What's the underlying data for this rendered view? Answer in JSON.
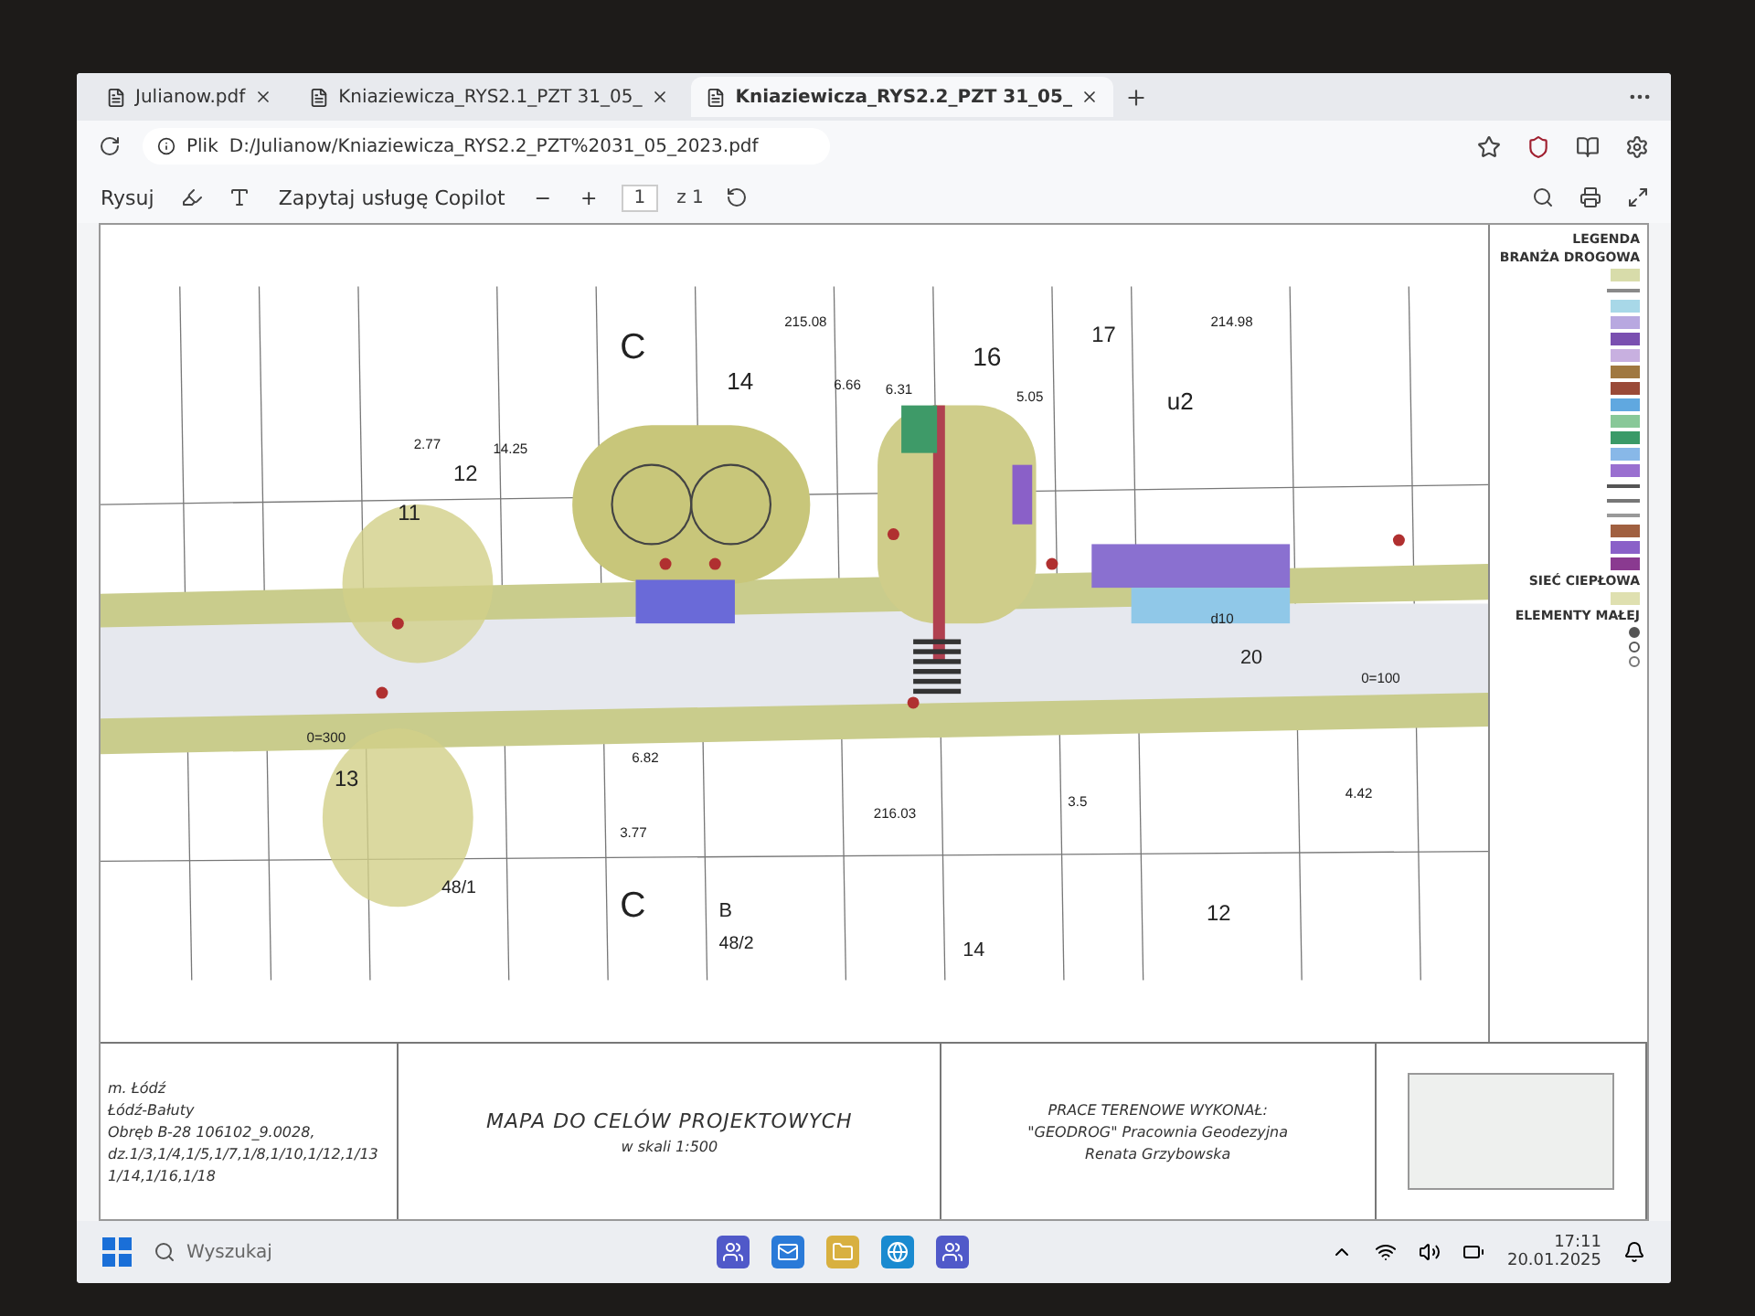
{
  "browser": {
    "tabs": [
      {
        "label": "Julianow.pdf",
        "selected": false
      },
      {
        "label": "Kniaziewicza_RYS2.1_PZT 31_05_",
        "selected": false
      },
      {
        "label": "Kniaziewicza_RYS2.2_PZT 31_05_",
        "selected": true
      }
    ],
    "address": {
      "scheme": "Plik",
      "url": "D:/Julianow/Kniaziewicza_RYS2.2_PZT%2031_05_2023.pdf"
    },
    "pdf_toolbar": {
      "draw": "Rysuj",
      "copilot": "Zapytaj usługę Copilot",
      "zoom_out": "−",
      "zoom_in": "+",
      "page": "1",
      "page_count": "z 1"
    }
  },
  "drawing": {
    "labels": [
      "C",
      "14",
      "16",
      "17",
      "u2",
      "11",
      "12",
      "13",
      "20",
      "B",
      "48/1",
      "48/2",
      "C",
      "14",
      "12",
      "6.66",
      "6.31",
      "5.05",
      "14.25",
      "2.77",
      "3.77",
      "3.5",
      "4.42",
      "6.82",
      "215.08",
      "214.98",
      "216.03",
      "d10",
      "0=100",
      "0=300"
    ],
    "legend": {
      "title": "LEGENDA",
      "sections": [
        {
          "heading": "BRANŻA DROGOWA",
          "items": [
            {
              "kind": "swatch",
              "color": "#d8dcaa"
            },
            {
              "kind": "line",
              "color": "#8a8a8a"
            },
            {
              "kind": "swatch",
              "color": "#a8d8e8"
            },
            {
              "kind": "swatch",
              "color": "#b8a8e0"
            },
            {
              "kind": "swatch",
              "color": "#7a4fb0"
            },
            {
              "kind": "swatch",
              "color": "#c8b0e0"
            },
            {
              "kind": "swatch",
              "color": "#a07840"
            },
            {
              "kind": "swatch",
              "color": "#9a4a38"
            },
            {
              "kind": "swatch",
              "color": "#60a8e0"
            },
            {
              "kind": "swatch",
              "color": "#88c898"
            },
            {
              "kind": "swatch",
              "color": "#3a9a68"
            },
            {
              "kind": "swatch",
              "color": "#88b8e8"
            },
            {
              "kind": "swatch",
              "color": "#9a70d0"
            },
            {
              "kind": "line",
              "color": "#555555"
            },
            {
              "kind": "line",
              "color": "#777777"
            },
            {
              "kind": "line",
              "color": "#999999"
            },
            {
              "kind": "swatch",
              "color": "#a06040"
            },
            {
              "kind": "swatch",
              "color": "#8a60c8"
            },
            {
              "kind": "swatch",
              "color": "#8a3a90"
            }
          ]
        },
        {
          "heading": "SIEĆ CIEPŁOWA",
          "items": [
            {
              "kind": "swatch",
              "color": "#dfe0b0"
            }
          ]
        },
        {
          "heading": "ELEMENTY MAŁEJ",
          "items": [
            {
              "kind": "dot",
              "color": "#555555"
            },
            {
              "kind": "ring",
              "color": "#555555"
            },
            {
              "kind": "ring",
              "color": "#777777"
            }
          ]
        }
      ]
    },
    "title_block": {
      "location": [
        "m. Łódź",
        "Łódź-Bałuty",
        "Obręb B-28 106102_9.0028,",
        "dz.1/3,1/4,1/5,1/7,1/8,1/10,1/12,1/13",
        "1/14,1/16,1/18"
      ],
      "title": "MAPA DO CELÓW PROJEKTOWYCH",
      "scale": "w skali 1:500",
      "surveyor": [
        "PRACE TERENOWE WYKONAŁ:",
        "\"GEODROG\" Pracownia Geodezyjna",
        "Renata Grzybowska"
      ]
    }
  },
  "taskbar": {
    "search_placeholder": "Wyszukaj",
    "time": "17:11",
    "date": "20.01.2025"
  }
}
